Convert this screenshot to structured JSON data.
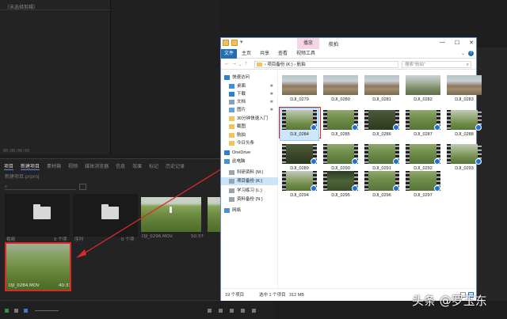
{
  "premiere": {
    "source_header": "（未选择剪辑）",
    "source_timecode": "00;00;00;00",
    "project_tabs": [
      "项目",
      "新建项目",
      "素材箱",
      "视频",
      "媒体浏览器",
      "信息",
      "效果",
      "标记",
      "历史记录"
    ],
    "project_file": "新建项目.prproj",
    "bins": [
      {
        "label": "视频",
        "count": "0 个项"
      },
      {
        "label": "序列",
        "count": "0 个项"
      }
    ],
    "clips": [
      {
        "name": "DJI_0296.MOV",
        "duration": "50:37"
      },
      {
        "name": "DJI_0284.MOV",
        "duration": "40:31"
      }
    ]
  },
  "explorer": {
    "ribbon_context_tab": "播放",
    "window_title": "航拍",
    "window_buttons": [
      "—",
      "☐",
      "✕"
    ],
    "ribbon_tabs": [
      "主页",
      "共享",
      "查看",
      "视频工具"
    ],
    "file_tab": "文件",
    "address_path": [
      "项目备份 (K:)",
      "航拍"
    ],
    "search_placeholder": "搜索\"航拍\"",
    "nav_items": [
      {
        "label": "快速访问",
        "icon": "star-icon",
        "indent": 0
      },
      {
        "label": "桌面",
        "icon": "desktop-icon",
        "indent": 1,
        "pinned": true
      },
      {
        "label": "下载",
        "icon": "download-icon",
        "indent": 1,
        "pinned": true
      },
      {
        "label": "文档",
        "icon": "document-icon",
        "indent": 1,
        "pinned": true
      },
      {
        "label": "图片",
        "icon": "picture-icon",
        "indent": 1,
        "pinned": true
      },
      {
        "label": "30分钟快速入门",
        "icon": "folder-icon",
        "indent": 1
      },
      {
        "label": "截图",
        "icon": "folder-icon",
        "indent": 1
      },
      {
        "label": "航拍",
        "icon": "folder-icon",
        "indent": 1
      },
      {
        "label": "今日头条",
        "icon": "folder-icon",
        "indent": 1
      },
      {
        "label": "OneDrive",
        "icon": "cloud-icon",
        "indent": 0
      },
      {
        "label": "此电脑",
        "icon": "computer-icon",
        "indent": 0
      },
      {
        "label": "科研资料 (M:)",
        "icon": "drive-icon",
        "indent": 1
      },
      {
        "label": "项目备份 (K:)",
        "icon": "drive-icon",
        "indent": 1,
        "selected": true
      },
      {
        "label": "学习练习 (L:)",
        "icon": "drive-icon",
        "indent": 1
      },
      {
        "label": "资料备份 (N:)",
        "icon": "drive-icon",
        "indent": 1
      },
      {
        "label": "网络",
        "icon": "network-icon",
        "indent": 0
      }
    ],
    "files": [
      {
        "name": "DJI_0279",
        "scene": "building",
        "film": false
      },
      {
        "name": "DJI_0280",
        "scene": "building",
        "film": false
      },
      {
        "name": "DJI_0281",
        "scene": "building",
        "film": false
      },
      {
        "name": "DJI_0282",
        "scene": "road",
        "film": false
      },
      {
        "name": "DJI_0283",
        "scene": "building",
        "film": false
      },
      {
        "name": "DJI_0284",
        "scene": "field",
        "film": true,
        "selected": true
      },
      {
        "name": "DJI_0285",
        "scene": "green",
        "film": true
      },
      {
        "name": "DJI_0286",
        "scene": "dark",
        "film": true
      },
      {
        "name": "DJI_0287",
        "scene": "green",
        "film": true
      },
      {
        "name": "DJI_0288",
        "scene": "field",
        "film": true
      },
      {
        "name": "DJI_0289",
        "scene": "dark",
        "film": true
      },
      {
        "name": "DJI_0290",
        "scene": "green",
        "film": true
      },
      {
        "name": "DJI_0291",
        "scene": "green",
        "film": true
      },
      {
        "name": "DJI_0292",
        "scene": "green",
        "film": true
      },
      {
        "name": "DJI_0293",
        "scene": "field",
        "film": true
      },
      {
        "name": "DJI_0294",
        "scene": "field",
        "film": true
      },
      {
        "name": "DJI_0295",
        "scene": "night",
        "film": true
      },
      {
        "name": "DJI_0296",
        "scene": "green",
        "film": true
      },
      {
        "name": "DJI_0297",
        "scene": "green",
        "film": true
      }
    ],
    "status_count": "19 个项目",
    "status_selected": "选中 1 个项目",
    "status_size": "312 MB"
  },
  "watermark": "头条 @罗玉东",
  "colors": {
    "accent": "#1f6fb2",
    "highlight": "#d92a2a"
  }
}
